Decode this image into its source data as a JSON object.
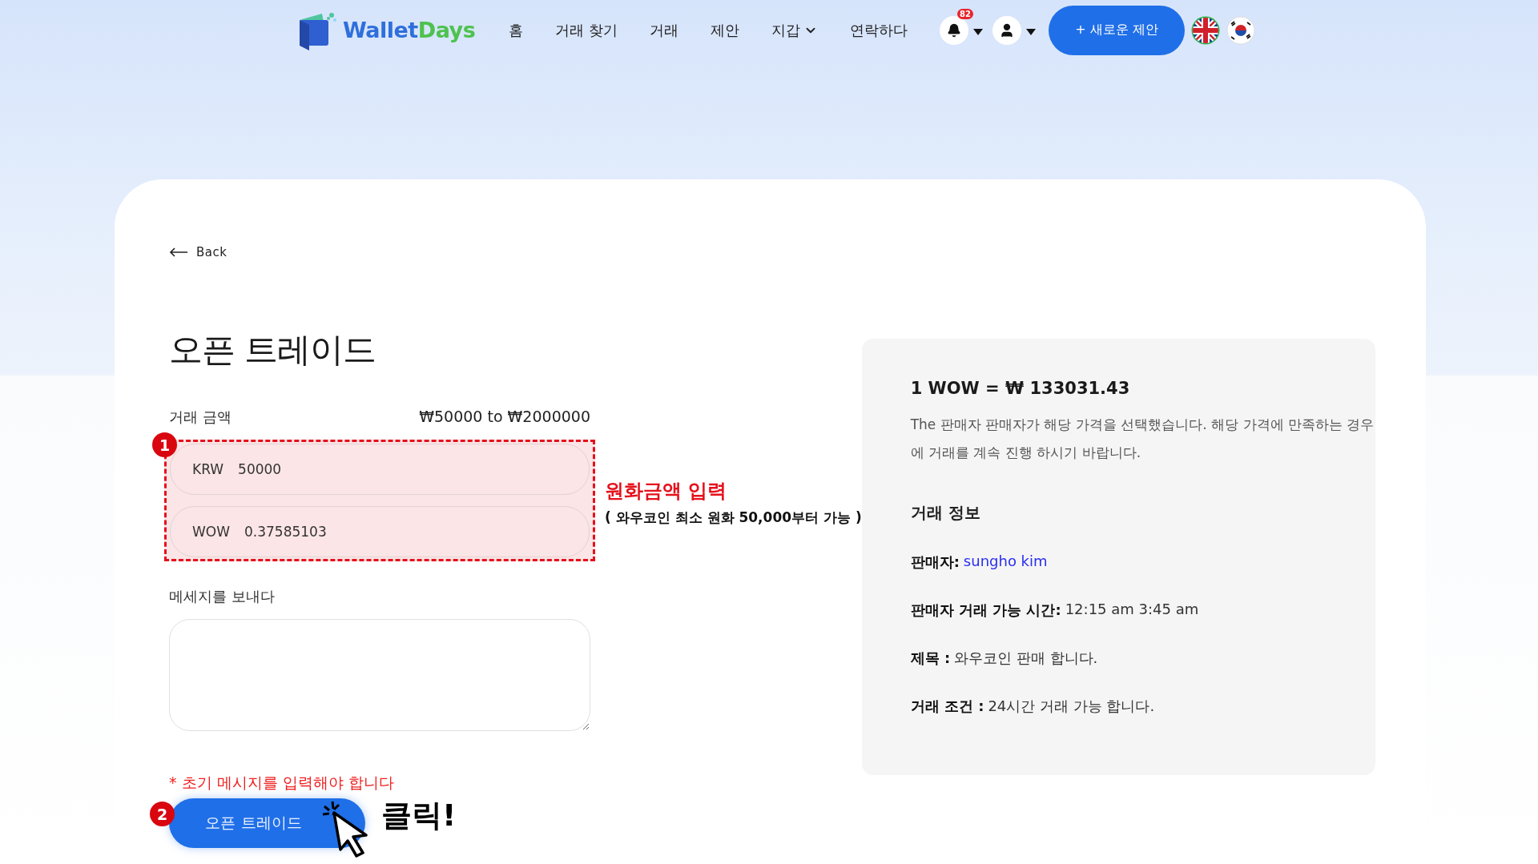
{
  "nav": {
    "logo": {
      "first": "Wallet",
      "second": "Days"
    },
    "items": [
      {
        "label": "홈",
        "dropdown": false
      },
      {
        "label": "거래 찾기",
        "dropdown": false
      },
      {
        "label": "거래",
        "dropdown": false
      },
      {
        "label": "제안",
        "dropdown": false
      },
      {
        "label": "지갑",
        "dropdown": true
      },
      {
        "label": "연락하다",
        "dropdown": false
      }
    ],
    "notification_count": "82",
    "new_offer_button": "+ 새로운 제안"
  },
  "back_link": "Back",
  "title": "오픈 트레이드",
  "amount": {
    "label": "거래 금액",
    "range": "₩50000 to ₩2000000",
    "fields": [
      {
        "currency": "KRW",
        "value": "50000"
      },
      {
        "currency": "WOW",
        "value": "0.37585103"
      }
    ]
  },
  "message": {
    "label": "메세지를 보내다"
  },
  "error": "* 초기 메시지를 입력해야 합니다",
  "submit_button": "오픈 트레이드",
  "annotations": {
    "step_1": "1",
    "step_2": "2",
    "amount_note": "원화금액 입력",
    "amount_hint": "( 와우코인 최소 원화 50,000부터 가능 )",
    "click_note": "클릭!"
  },
  "info_panel": {
    "rate": "1 WOW = ₩ 133031.43",
    "description": "The 판매자 판매자가 해당 가격을 선택했습니다. 해당 가격에 만족하는 경우에 거래를 계속 진행 하시기 바랍니다.",
    "heading": "거래 정보",
    "rows": [
      {
        "label": "판매자:",
        "value": "sungho kim",
        "kind": "link"
      },
      {
        "label": "판매자 거래 가능 시간:",
        "value": "12:15 am 3:45 am",
        "kind": "text"
      },
      {
        "label": "제목 :",
        "value": "와우코인 판매 합니다.",
        "kind": "text"
      },
      {
        "label": "거래 조건 :",
        "value": "24시간 거래 가능 합니다.",
        "kind": "text"
      }
    ]
  }
}
